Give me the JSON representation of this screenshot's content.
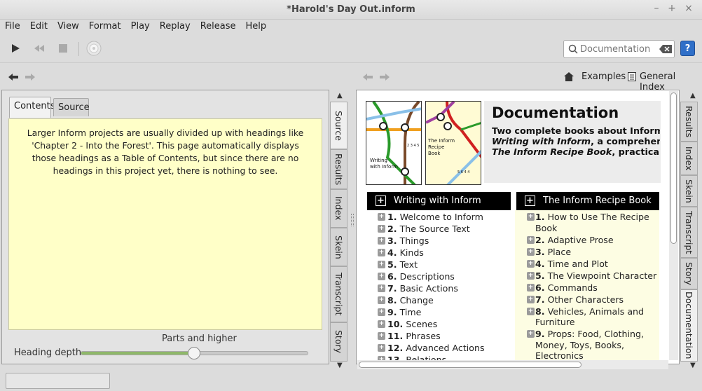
{
  "window": {
    "title": "*Harold's Day Out.inform"
  },
  "menu": [
    "File",
    "Edit",
    "View",
    "Format",
    "Play",
    "Replay",
    "Release",
    "Help"
  ],
  "toolbar": {
    "search_placeholder": "Documentation",
    "help_label": "?"
  },
  "right_nav": {
    "examples": "Examples",
    "general_index": "General Index"
  },
  "left_panel": {
    "tabs": [
      "Contents",
      "Source"
    ],
    "contents_text": "Larger Inform projects are usually divided up with headings like 'Chapter 2 - Into the Forest'. This page automatically displays those headings as a Table of Contents, but since there are no headings in this project yet, there is nothing to see.",
    "slider_caption": "Parts and higher",
    "heading_depth_label": "Heading depth",
    "heading_depth_level": 0.48,
    "side_tabs": [
      "Source",
      "Results",
      "Index",
      "Skein",
      "Transcript",
      "Story"
    ]
  },
  "right_panel": {
    "side_tabs": [
      "Results",
      "Index",
      "Skein",
      "Transcript",
      "Story",
      "Documentation"
    ],
    "doc_title": "Documentation",
    "doc_subtitle_1": "Two complete books about Inform:",
    "doc_subtitle_2_italic": "Writing with Inform",
    "doc_subtitle_2_rest": ", a comprehensive",
    "doc_subtitle_3_italic": "The Inform Recipe Book",
    "doc_subtitle_3_rest": ", practical solu",
    "book1_label": "Writing with Inform",
    "book1_code": "2 3 4 5",
    "book2_label": "The Inform Recipe Book",
    "book2_code": "5 6 4 4",
    "writing_header": "Writing with Inform",
    "recipe_header": "The Inform Recipe Book",
    "writing_items": [
      {
        "num": "1.",
        "text": "Welcome to Inform"
      },
      {
        "num": "2.",
        "text": "The Source Text"
      },
      {
        "num": "3.",
        "text": "Things"
      },
      {
        "num": "4.",
        "text": "Kinds"
      },
      {
        "num": "5.",
        "text": "Text"
      },
      {
        "num": "6.",
        "text": "Descriptions"
      },
      {
        "num": "7.",
        "text": "Basic Actions"
      },
      {
        "num": "8.",
        "text": "Change"
      },
      {
        "num": "9.",
        "text": "Time"
      },
      {
        "num": "10.",
        "text": "Scenes"
      },
      {
        "num": "11.",
        "text": "Phrases"
      },
      {
        "num": "12.",
        "text": "Advanced Actions"
      },
      {
        "num": "13.",
        "text": "Relations"
      }
    ],
    "recipe_items": [
      {
        "num": "1.",
        "text": "How to Use The Recipe Book"
      },
      {
        "num": "2.",
        "text": "Adaptive Prose"
      },
      {
        "num": "3.",
        "text": "Place"
      },
      {
        "num": "4.",
        "text": "Time and Plot"
      },
      {
        "num": "5.",
        "text": "The Viewpoint Character"
      },
      {
        "num": "6.",
        "text": "Commands"
      },
      {
        "num": "7.",
        "text": "Other Characters"
      },
      {
        "num": "8.",
        "text": "Vehicles, Animals and Furniture"
      },
      {
        "num": "9.",
        "text": "Props: Food, Clothing, Money, Toys, Books, Electronics"
      }
    ]
  }
}
